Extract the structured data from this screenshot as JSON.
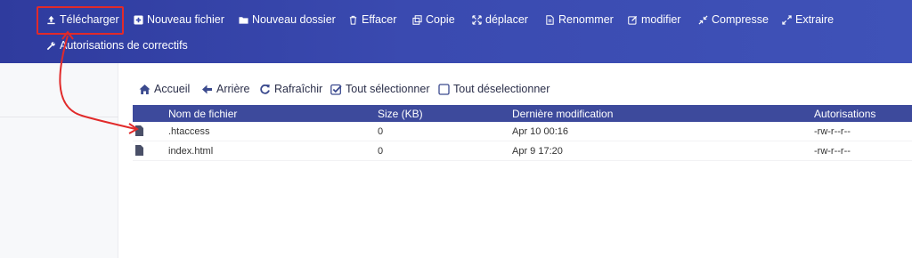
{
  "toolbar": {
    "upload": "Télécharger",
    "new_file": "Nouveau fichier",
    "new_folder": "Nouveau dossier",
    "delete": "Effacer",
    "copy": "Copie",
    "move": "déplacer",
    "rename": "Renommer",
    "edit": "modifier",
    "compress": "Compresse",
    "extract": "Extraire",
    "permissions": "Autorisations de correctifs"
  },
  "nav": {
    "home": "Accueil",
    "back": "Arrière",
    "refresh": "Rafraîchir",
    "select_all": "Tout sélectionner",
    "deselect_all": "Tout déselectionner"
  },
  "table": {
    "headers": {
      "name": "Nom de fichier",
      "size": "Size (KB)",
      "modified": "Dernière modification",
      "permissions": "Autorisations"
    },
    "rows": [
      {
        "name": ".htaccess",
        "size": "0",
        "modified": "Apr 10 00:16",
        "permissions": "-rw-r--r--"
      },
      {
        "name": "index.html",
        "size": "0",
        "modified": "Apr 9 17:20",
        "permissions": "-rw-r--r--"
      }
    ]
  },
  "colors": {
    "toolbar_bg": "#3a4ab0",
    "header_bg": "#3d4a9c",
    "highlight": "#e12a2a"
  }
}
